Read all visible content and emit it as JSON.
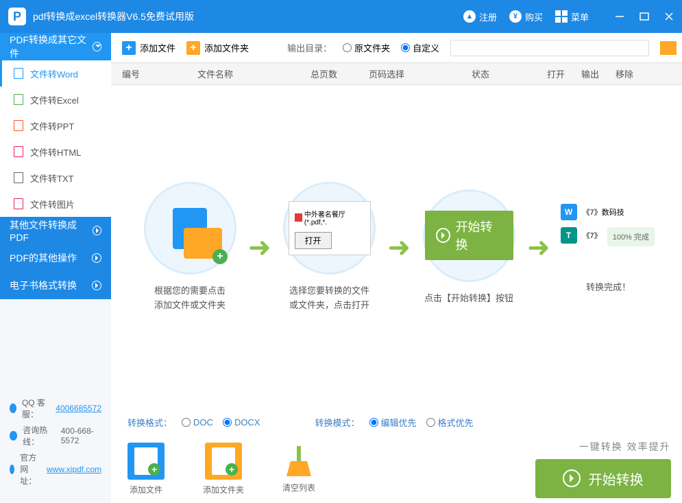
{
  "title": "pdf转换成excel转换器V6.5免费试用版",
  "titlebar": {
    "register": "注册",
    "buy": "购买",
    "menu": "菜单"
  },
  "sidebar": {
    "cat1": "PDF转换成其它文件",
    "items": [
      {
        "label": "文件转Word"
      },
      {
        "label": "文件转Excel"
      },
      {
        "label": "文件转PPT"
      },
      {
        "label": "文件转HTML"
      },
      {
        "label": "文件转TXT"
      },
      {
        "label": "文件转图片"
      }
    ],
    "cat2": "其他文件转换成PDF",
    "cat3": "PDF的其他操作",
    "cat4": "电子书格式转换"
  },
  "footer": {
    "qq_label": "QQ 客服：",
    "qq": "4006685572",
    "hotline_label": "咨询热线：",
    "hotline": "400-668-5572",
    "site_label": "官方网址：",
    "site": "www.xjpdf.com"
  },
  "toolbar": {
    "add_file": "添加文件",
    "add_folder": "添加文件夹",
    "output_label": "输出目录：",
    "orig_folder": "原文件夹",
    "custom": "自定义"
  },
  "table": {
    "h1": "编号",
    "h2": "文件名称",
    "h3": "总页数",
    "h4": "页码选择",
    "h5": "状态",
    "h6": "打开",
    "h7": "输出",
    "h8": "移除"
  },
  "steps": {
    "s1": "根据您的需要点击\n添加文件或文件夹",
    "s2": "选择您要转换的文件\n或文件夹，点击打开",
    "s2_file": "中外著名餐厅(*.pdf,*.",
    "s2_open": "打开",
    "s3_btn": "开始转换",
    "s3": "点击【开始转换】按钮",
    "s4": "转换完成！",
    "s4_item1": "《7》数码技",
    "s4_item2": "《7》",
    "s4_done": "100%  完成"
  },
  "options": {
    "fmt_label": "转换格式：",
    "doc": "DOC",
    "docx": "DOCX",
    "mode_label": "转换模式：",
    "edit": "编辑优先",
    "format": "格式优先"
  },
  "bottom": {
    "add_file": "添加文件",
    "add_folder": "添加文件夹",
    "clear": "清空列表",
    "slogan": "一键转换  效率提升",
    "convert": "开始转换"
  }
}
